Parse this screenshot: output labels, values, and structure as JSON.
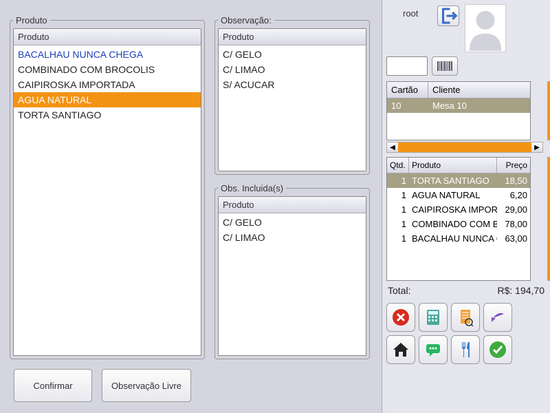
{
  "produto": {
    "legend": "Produto",
    "header": "Produto",
    "items": [
      {
        "label": "BACALHAU NUNCA CHEGA",
        "first": true
      },
      {
        "label": "COMBINADO COM BROCOLIS"
      },
      {
        "label": "CAIPIROSKA IMPORTADA"
      },
      {
        "label": "AGUA NATURAL",
        "selected": true
      },
      {
        "label": "TORTA SANTIAGO"
      }
    ]
  },
  "observacao": {
    "legend": "Observação:",
    "header": "Produto",
    "items": [
      {
        "label": "C/ GELO"
      },
      {
        "label": "C/ LIMAO"
      },
      {
        "label": "S/ ACUCAR"
      }
    ]
  },
  "obs_incluidas": {
    "legend": "Obs. Incluida(s)",
    "header": "Produto",
    "items": [
      {
        "label": "C/ GELO"
      },
      {
        "label": "C/ LIMAO"
      }
    ]
  },
  "buttons": {
    "confirmar": "Confirmar",
    "obs_livre": "Observação Livre"
  },
  "user": {
    "name": "root"
  },
  "card_table": {
    "headers": {
      "cartao": "Cartão",
      "cliente": "Cliente"
    },
    "row": {
      "cartao": "10",
      "cliente": "Mesa 10"
    }
  },
  "order_table": {
    "headers": {
      "qtd": "Qtd.",
      "produto": "Produto",
      "preco": "Preço"
    },
    "rows": [
      {
        "qtd": "1",
        "produto": "TORTA SANTIAGO",
        "preco": "18,50",
        "selected": true
      },
      {
        "qtd": "1",
        "produto": "AGUA NATURAL",
        "preco": "6,20"
      },
      {
        "qtd": "1",
        "produto": "CAIPIROSKA IMPORTADA",
        "preco": "29,00"
      },
      {
        "qtd": "1",
        "produto": "COMBINADO COM BROCOLIS",
        "preco": "78,00"
      },
      {
        "qtd": "1",
        "produto": "BACALHAU NUNCA CHEGA",
        "preco": "63,00"
      }
    ]
  },
  "total": {
    "label": "Total:",
    "value": "R$: 194,70"
  },
  "colors": {
    "accent": "#f39313",
    "selrow": "#a6a085"
  }
}
